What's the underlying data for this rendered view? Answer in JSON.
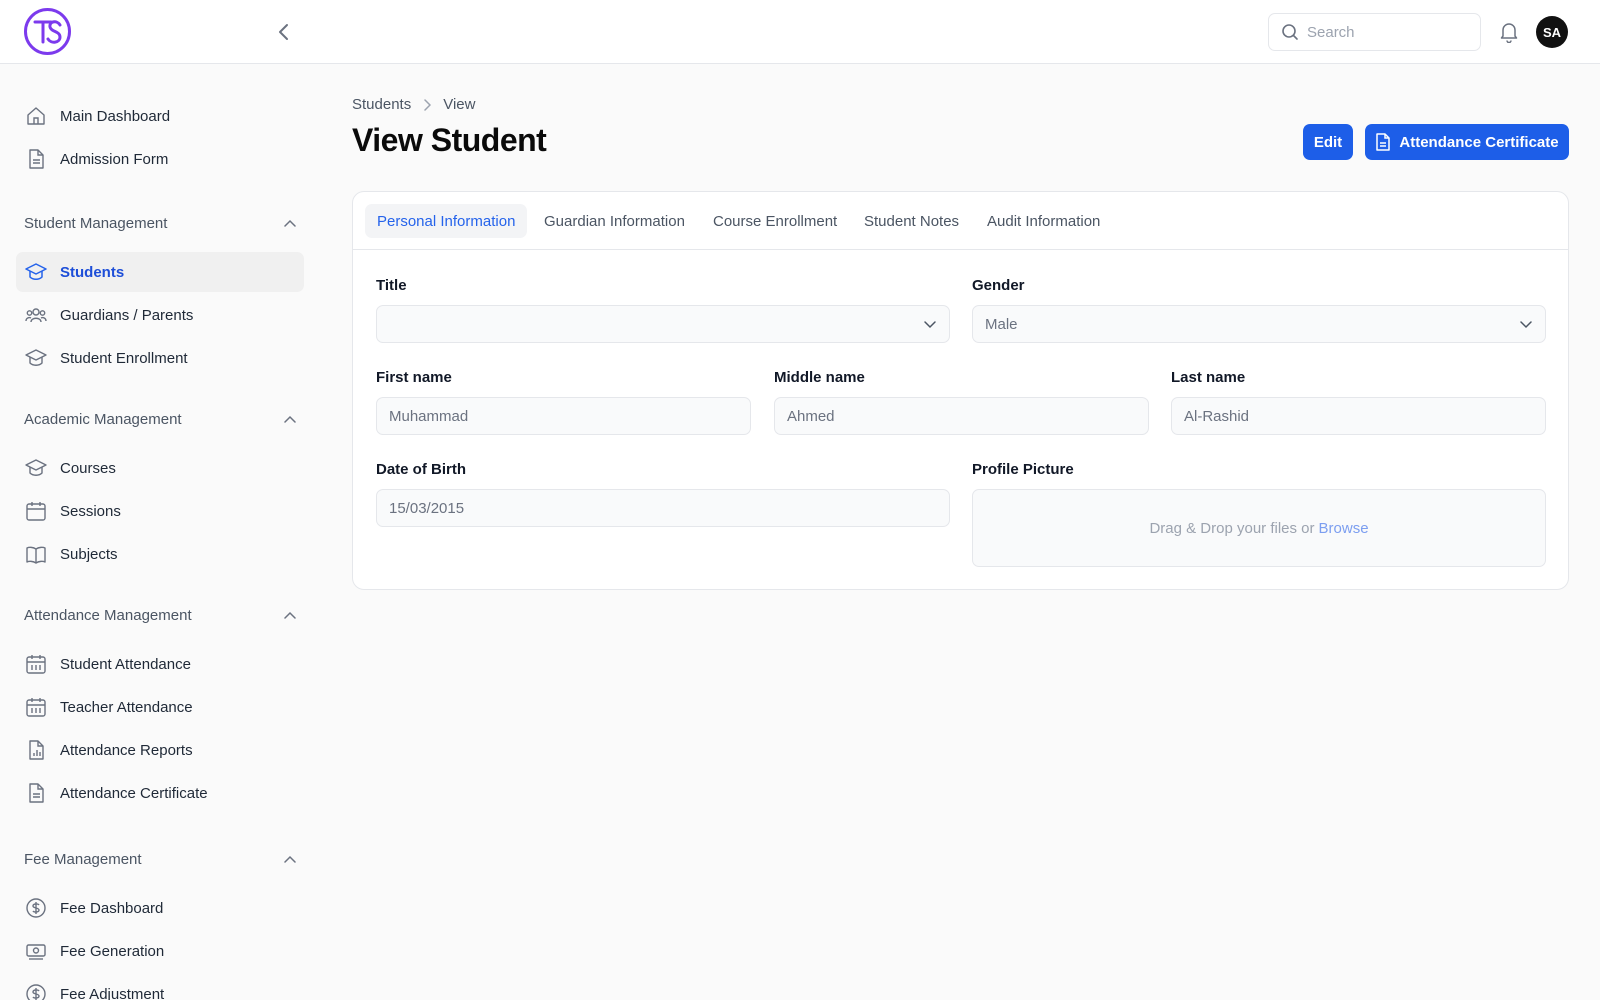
{
  "app": {
    "logo_text": "TS",
    "avatar_initials": "SA"
  },
  "search": {
    "placeholder": "Search"
  },
  "sidebar": {
    "top_items": [
      {
        "label": "Main Dashboard",
        "icon": "home-icon"
      },
      {
        "label": "Admission Form",
        "icon": "document-icon"
      }
    ],
    "sections": [
      {
        "title": "Student Management",
        "items": [
          {
            "label": "Students",
            "icon": "graduation-cap-icon",
            "active": true
          },
          {
            "label": "Guardians / Parents",
            "icon": "users-icon"
          },
          {
            "label": "Student Enrollment",
            "icon": "graduation-cap-icon"
          }
        ]
      },
      {
        "title": "Academic Management",
        "items": [
          {
            "label": "Courses",
            "icon": "graduation-cap-icon"
          },
          {
            "label": "Sessions",
            "icon": "calendar-icon"
          },
          {
            "label": "Subjects",
            "icon": "book-icon"
          }
        ]
      },
      {
        "title": "Attendance Management",
        "items": [
          {
            "label": "Student Attendance",
            "icon": "calendar-grid-icon"
          },
          {
            "label": "Teacher Attendance",
            "icon": "calendar-grid-icon"
          },
          {
            "label": "Attendance Reports",
            "icon": "report-icon"
          },
          {
            "label": "Attendance Certificate",
            "icon": "document-icon"
          }
        ]
      },
      {
        "title": "Fee Management",
        "items": [
          {
            "label": "Fee Dashboard",
            "icon": "dollar-circle-icon"
          },
          {
            "label": "Fee Generation",
            "icon": "banknote-icon"
          },
          {
            "label": "Fee Adjustment",
            "icon": "dollar-circle-icon"
          }
        ]
      }
    ]
  },
  "breadcrumb": {
    "parent": "Students",
    "current": "View"
  },
  "page": {
    "title": "View Student"
  },
  "actions": {
    "edit": "Edit",
    "certificate": "Attendance Certificate"
  },
  "tabs": [
    {
      "label": "Personal Information",
      "active": true
    },
    {
      "label": "Guardian Information"
    },
    {
      "label": "Course Enrollment"
    },
    {
      "label": "Student Notes"
    },
    {
      "label": "Audit Information"
    }
  ],
  "form": {
    "title": {
      "label": "Title",
      "value": ""
    },
    "gender": {
      "label": "Gender",
      "value": "Male"
    },
    "first_name": {
      "label": "First name",
      "value": "Muhammad"
    },
    "middle_name": {
      "label": "Middle name",
      "value": "Ahmed"
    },
    "last_name": {
      "label": "Last name",
      "value": "Al-Rashid"
    },
    "dob": {
      "label": "Date of Birth",
      "value": "15/03/2015"
    },
    "profile_picture": {
      "label": "Profile Picture",
      "drop_text": "Drag & Drop your files or",
      "browse": "Browse"
    }
  },
  "colors": {
    "primary": "#1d5ee8",
    "active_text": "#1d4ed8",
    "logo": "#7c3aed"
  }
}
